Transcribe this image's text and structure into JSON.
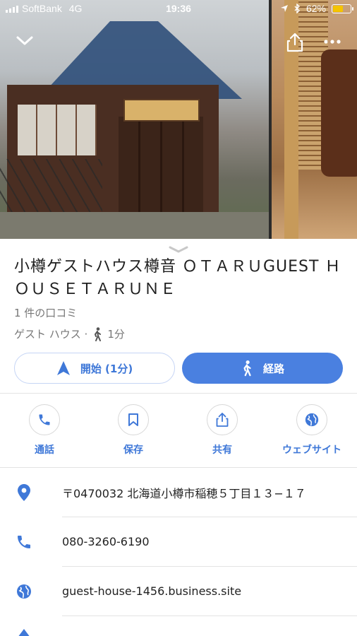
{
  "status_bar": {
    "carrier": "SoftBank",
    "network": "4G",
    "time": "19:36",
    "battery_percent": "62%",
    "battery_level": 0.62
  },
  "place": {
    "title": "小樽ゲストハウス樽音 ＯＴＡＲＵGUEST ＨＯＵＳＥＴＡＲＵＮＥ",
    "reviews": "1 件の口コミ",
    "category": "ゲスト ハウス ·",
    "walk_time": "1分"
  },
  "buttons": {
    "start": "開始 (1分)",
    "route": "経路"
  },
  "actions": [
    {
      "label": "通話",
      "icon": "phone-icon"
    },
    {
      "label": "保存",
      "icon": "bookmark-icon"
    },
    {
      "label": "共有",
      "icon": "share-icon"
    },
    {
      "label": "ウェブサイト",
      "icon": "globe-icon"
    }
  ],
  "info": {
    "address": "〒0470032 北海道小樽市稲穂５丁目１３−１７",
    "phone": "080-3260-6190",
    "website": "guest-house-1456.business.site"
  },
  "colors": {
    "accent": "#4a80e0",
    "accent_text": "#3f78d8",
    "battery": "#f5c400"
  }
}
